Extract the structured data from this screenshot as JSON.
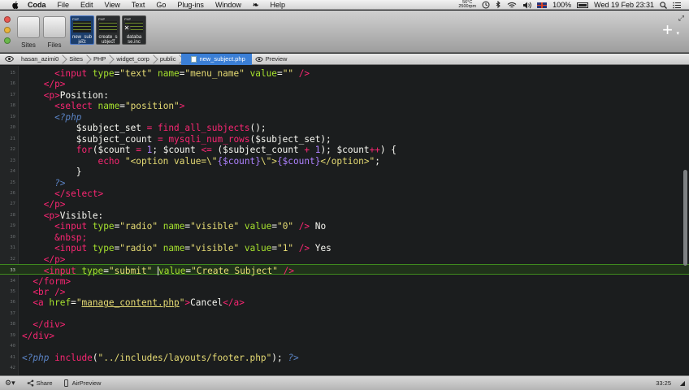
{
  "menubar": {
    "app_name": "Coda",
    "menus": [
      "File",
      "Edit",
      "View",
      "Text",
      "Go",
      "Plug-ins",
      "Window",
      "Help"
    ],
    "temperature": "56°C",
    "temperature_sub": "2500rpm",
    "battery": "100%",
    "battery_level": 1.0,
    "datetime": "Wed 19 Feb  23:31"
  },
  "toolbar": {
    "sites_label": "Sites",
    "files_label": "Files",
    "tabs": [
      {
        "tag": "PHP",
        "name": "new_sub ject",
        "active": true
      },
      {
        "tag": "PHP",
        "name": "create_s ubject",
        "active": false
      },
      {
        "tag": "PHP",
        "name": "databa se.inc",
        "active": false
      }
    ]
  },
  "pathbar": {
    "crumbs": [
      "hasan_azimi0",
      "Sites",
      "PHP",
      "widget_corp",
      "public"
    ],
    "active_file": "new_subject.php",
    "preview_label": "Preview"
  },
  "editor": {
    "lines": [
      {
        "n": "15",
        "html": "      <span class=\"t-tag\">&lt;input</span> <span class=\"t-attr\">type</span>=<span class=\"t-str\">\"text\"</span> <span class=\"t-attr\">name</span>=<span class=\"t-str\">\"menu_name\"</span> <span class=\"t-attr\">value</span>=<span class=\"t-str\">\"\"</span> <span class=\"t-tag\">/&gt;</span>"
      },
      {
        "n": "16",
        "html": "    <span class=\"t-tag\">&lt;/p&gt;</span>"
      },
      {
        "n": "17",
        "html": "    <span class=\"t-tag\">&lt;p&gt;</span>Position:"
      },
      {
        "n": "18",
        "html": "      <span class=\"t-tag\">&lt;select</span> <span class=\"t-attr\">name</span>=<span class=\"t-str\">\"position\"</span><span class=\"t-tag\">&gt;</span>"
      },
      {
        "n": "19",
        "html": "      <span class=\"t-php\">&lt;?php</span>"
      },
      {
        "n": "20",
        "html": "          $subject_set <span class=\"t-op\">=</span> <span class=\"t-fn\">find_all_subjects</span>();"
      },
      {
        "n": "21",
        "html": "          $subject_count <span class=\"t-op\">=</span> <span class=\"t-fn\">mysqli_num_rows</span>($subject_set);"
      },
      {
        "n": "22",
        "html": "          <span class=\"t-kw\">for</span>($count <span class=\"t-op\">=</span> <span class=\"t-num\">1</span>; $count <span class=\"t-op\">&lt;=</span> ($subject_count <span class=\"t-op\">+</span> <span class=\"t-num\">1</span>); $count<span class=\"t-op\">++</span>) {"
      },
      {
        "n": "23",
        "html": "              <span class=\"t-kw\">echo</span> <span class=\"t-str\">\"&lt;option value=\\\"</span><span class=\"t-num\">{$count}</span><span class=\"t-str\">\\\"&gt;</span><span class=\"t-num\">{$count}</span><span class=\"t-str\">&lt;/option&gt;\"</span>;"
      },
      {
        "n": "24",
        "html": "          }"
      },
      {
        "n": "25",
        "html": "      <span class=\"t-php\">?&gt;</span>"
      },
      {
        "n": "26",
        "html": "      <span class=\"t-tag\">&lt;/select&gt;</span>"
      },
      {
        "n": "27",
        "html": "    <span class=\"t-tag\">&lt;/p&gt;</span>"
      },
      {
        "n": "28",
        "html": "    <span class=\"t-tag\">&lt;p&gt;</span>Visible:"
      },
      {
        "n": "29",
        "html": "      <span class=\"t-tag\">&lt;input</span> <span class=\"t-attr\">type</span>=<span class=\"t-str\">\"radio\"</span> <span class=\"t-attr\">name</span>=<span class=\"t-str\">\"visible\"</span> <span class=\"t-attr\">value</span>=<span class=\"t-str\">\"0\"</span> <span class=\"t-tag\">/&gt;</span> No"
      },
      {
        "n": "30",
        "html": "      <span class=\"t-fn\">&amp;nbsp;</span>"
      },
      {
        "n": "31",
        "html": "      <span class=\"t-tag\">&lt;input</span> <span class=\"t-attr\">type</span>=<span class=\"t-str\">\"radio\"</span> <span class=\"t-attr\">name</span>=<span class=\"t-str\">\"visible\"</span> <span class=\"t-attr\">value</span>=<span class=\"t-str\">\"1\"</span> <span class=\"t-tag\">/&gt;</span> Yes"
      },
      {
        "n": "32",
        "html": "    <span class=\"t-tag\">&lt;/p&gt;</span>"
      },
      {
        "n": "33",
        "html": "    <span class=\"t-tag\">&lt;input</span> <span class=\"t-attr\">type</span>=<span class=\"t-str\">\"submit\"</span> <span class=\"caret\"></span><span class=\"t-attr\">value</span>=<span class=\"t-str\">\"Create Subject\"</span> <span class=\"t-tag\">/&gt;</span>",
        "current": true
      },
      {
        "n": "34",
        "html": "  <span class=\"t-tag\">&lt;/form&gt;</span>"
      },
      {
        "n": "35",
        "html": "  <span class=\"t-tag\">&lt;br /&gt;</span>"
      },
      {
        "n": "36",
        "html": "  <span class=\"t-tag\">&lt;a</span> <span class=\"t-attr\">href</span>=<span class=\"t-str\">\"</span><span class=\"t-link\">manage_content.php</span><span class=\"t-str\">\"</span><span class=\"t-tag\">&gt;</span>Cancel<span class=\"t-tag\">&lt;/a&gt;</span>"
      },
      {
        "n": "37",
        "html": ""
      },
      {
        "n": "38",
        "html": "  <span class=\"t-tag\">&lt;/div&gt;</span>"
      },
      {
        "n": "39",
        "html": "<span class=\"t-tag\">&lt;/div&gt;</span>"
      },
      {
        "n": "40",
        "html": ""
      },
      {
        "n": "41",
        "html": "<span class=\"t-php\">&lt;?php</span> <span class=\"t-fn\">include</span>(<span class=\"t-str\">\"../includes/layouts/footer.php\"</span>); <span class=\"t-php\">?&gt;</span>"
      },
      {
        "n": "42",
        "html": ""
      }
    ]
  },
  "statusbar": {
    "share_label": "Share",
    "airpreview_label": "AirPreview",
    "cursor_position": "33:25"
  }
}
